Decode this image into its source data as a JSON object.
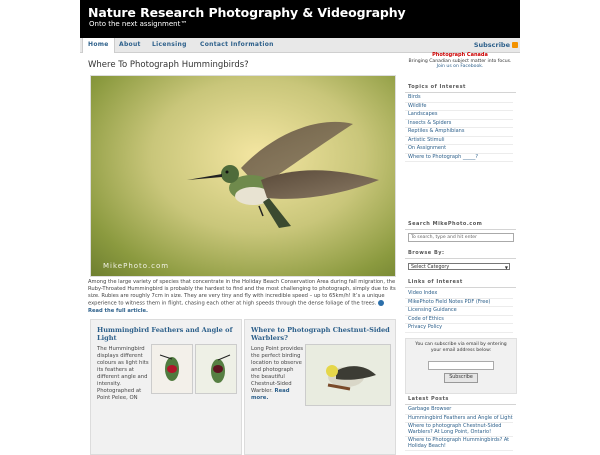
{
  "site": {
    "title": "Nature Research Photography & Videography",
    "tagline": "Onto the next assignment™"
  },
  "nav": {
    "items": [
      "Home",
      "About",
      "Licensing",
      "Contact Information"
    ],
    "subscribe": "Subscribe"
  },
  "post": {
    "title": "Where To Photograph Hummingbirds?",
    "watermark": "MikePhoto.com",
    "excerpt": "Among the large variety of species that concentrate in the Holiday Beach Conservation Area during fall migration, the Ruby-Throated Hummingbird is probably the hardest to find and the most challenging to photograph, simply due to its size. Rubies are roughly 7cm in size. They are very tiny and fly with incredible speed – up to 65km/h! It’s a unique experience to witness them in flight, chasing each other at high speeds through the dense foliage of the trees.",
    "read_more": "Read the full article."
  },
  "cards": [
    {
      "title": "Hummingbird Feathers and Angle of Light",
      "text": "The Hummingbird displays different colours as light hits its feathers at different angle and intensity. Photographed at Point Pelee, ON"
    },
    {
      "title": "Where to Photograph Chestnut-Sided Warblers?",
      "text": "Long Point provides the perfect birding location to observe and photograph the beautiful Chestnut-Sided Warbler.",
      "read_more": "Read more."
    }
  ],
  "sidebar": {
    "promo_title": "Photograph Canada",
    "promo_text": "Bringing Canadian subject matter into focus.",
    "promo_link": "Join us on Facebook.",
    "topics_title": "Topics of Interest",
    "topics": [
      "Birds",
      "Wildlife",
      "Landscapes",
      "Insects & Spiders",
      "Reptiles & Amphibians",
      "Artistic Stimuli",
      "On Assignment",
      "Where to Photograph _____?"
    ],
    "search_title": "Search MikePhoto.com",
    "search_placeholder": "To search, type and hit enter",
    "browse_title": "Browse By:",
    "browse_select": "Select Category",
    "links_title": "Links of Interest",
    "links": [
      "Video Index",
      "MikePhoto Field Notes PDF (Free)",
      "Licensing Guidance",
      "Code of Ethics",
      "Privacy Policy"
    ],
    "email_prompt": "You can subscribe via email by entering your email address below:",
    "subscribe_button": "Subscribe",
    "latest_title": "Latest Posts",
    "latest": [
      "Garbage Browser",
      "Hummingbird Feathers and Angle of Light",
      "Where to photograph Chestnut-Sided Warblers? At Long Point, Ontario!",
      "Where to Photograph Hummingbirds? At Holiday Beach!"
    ]
  },
  "colors": {
    "header_bg": "#000000",
    "link": "#2c5f8a",
    "promo_red": "#cc0000"
  }
}
